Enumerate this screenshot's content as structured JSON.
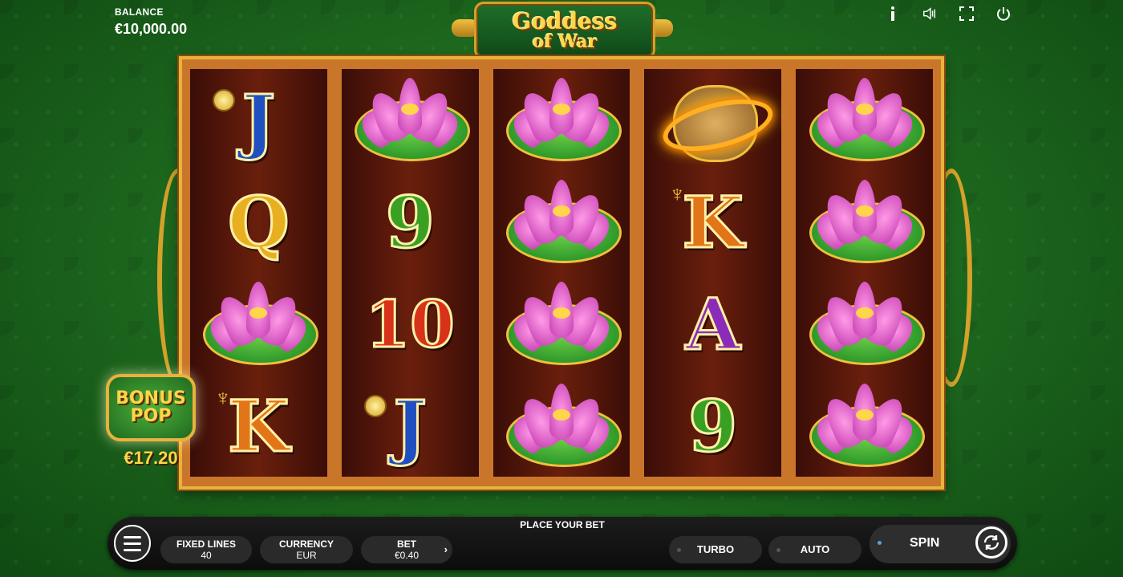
{
  "header": {
    "balance_label": "BALANCE",
    "balance_value": "€10,000.00",
    "icons": [
      "info-icon",
      "sound-icon",
      "fullscreen-icon",
      "power-icon"
    ]
  },
  "logo": {
    "line1": "Goddess",
    "line2": "of War"
  },
  "reels": [
    [
      "J",
      "Q",
      "lotus",
      "K"
    ],
    [
      "lotus",
      "9",
      "10",
      "J"
    ],
    [
      "lotus",
      "lotus",
      "lotus",
      "lotus"
    ],
    [
      "fire-ring",
      "K",
      "A",
      "9"
    ],
    [
      "lotus",
      "lotus",
      "lotus",
      "lotus"
    ]
  ],
  "bonus_pop": {
    "line1": "BONUS",
    "line2": "POP",
    "amount": "€17.20"
  },
  "controls": {
    "place_bet": "PLACE YOUR BET",
    "fixed_lines_label": "FIXED LINES",
    "fixed_lines_value": "40",
    "currency_label": "CURRENCY",
    "currency_value": "EUR",
    "bet_label": "BET",
    "bet_value": "€0.40",
    "turbo_label": "TURBO",
    "auto_label": "AUTO",
    "spin_label": "SPIN"
  },
  "colors": {
    "background": "#1f6a1f",
    "frame_gold": "#e9b23a",
    "reel_bg": "#6a1f0c"
  }
}
